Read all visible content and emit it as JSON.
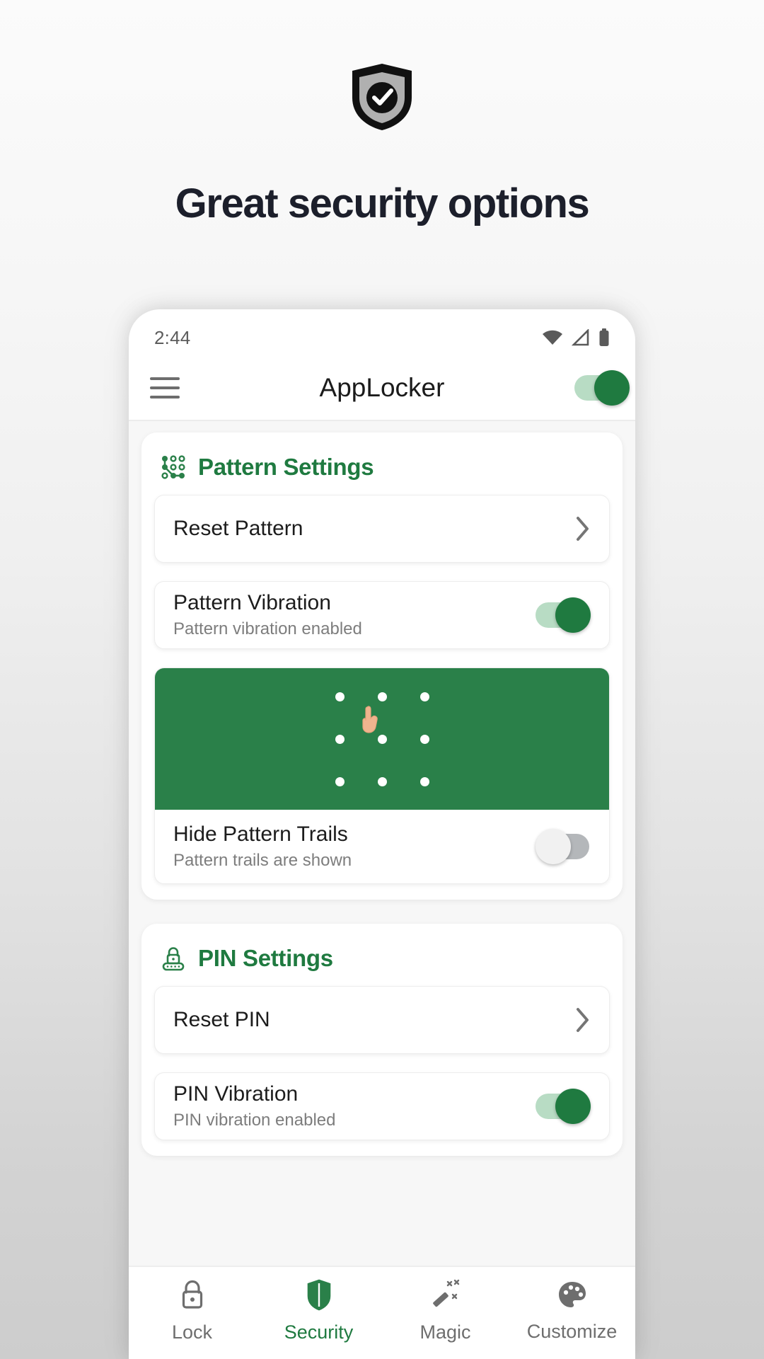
{
  "promo": {
    "headline": "Great security options",
    "hero_icon": "shield-check-icon",
    "colors": {
      "headline": "#1c1f2b",
      "brand_green": "#1f7a40",
      "preview_green": "#2a8049"
    }
  },
  "phone": {
    "status_bar": {
      "time": "2:44",
      "icons": [
        "wifi-icon",
        "signal-icon",
        "battery-icon"
      ]
    },
    "app_bar": {
      "menu_icon": "hamburger-menu-icon",
      "title": "AppLocker",
      "master_toggle": {
        "name": "master-lock-toggle",
        "state": "on"
      }
    },
    "sections": [
      {
        "id": "pattern",
        "icon": "pattern-dots-icon",
        "title": "Pattern Settings",
        "rows": [
          {
            "type": "nav",
            "name": "reset-pattern",
            "title": "Reset Pattern",
            "chevron": "chevron-right-icon"
          },
          {
            "type": "toggle",
            "name": "pattern-vibration",
            "title": "Pattern Vibration",
            "subtitle": "Pattern vibration enabled",
            "state": "on"
          },
          {
            "type": "preview-toggle",
            "name": "hide-pattern-trails",
            "title": "Hide Pattern Trails",
            "subtitle": "Pattern trails are shown",
            "state": "off",
            "preview": {
              "name": "pattern-preview",
              "dots": 9,
              "cursor": "pointing-hand-cursor"
            }
          }
        ]
      },
      {
        "id": "pin",
        "icon": "pin-lock-icon",
        "title": "PIN Settings",
        "rows": [
          {
            "type": "nav",
            "name": "reset-pin",
            "title": "Reset PIN",
            "chevron": "chevron-right-icon"
          },
          {
            "type": "toggle",
            "name": "pin-vibration",
            "title": "PIN Vibration",
            "subtitle": "PIN vibration enabled",
            "state": "on"
          }
        ]
      }
    ],
    "bottom_nav": [
      {
        "name": "nav-lock",
        "label": "Lock",
        "icon": "padlock-icon",
        "active": false
      },
      {
        "name": "nav-security",
        "label": "Security",
        "icon": "shield-icon",
        "active": true
      },
      {
        "name": "nav-magic",
        "label": "Magic",
        "icon": "magic-wand-icon",
        "active": false
      },
      {
        "name": "nav-customize",
        "label": "Customize",
        "icon": "palette-icon",
        "active": false
      }
    ]
  }
}
